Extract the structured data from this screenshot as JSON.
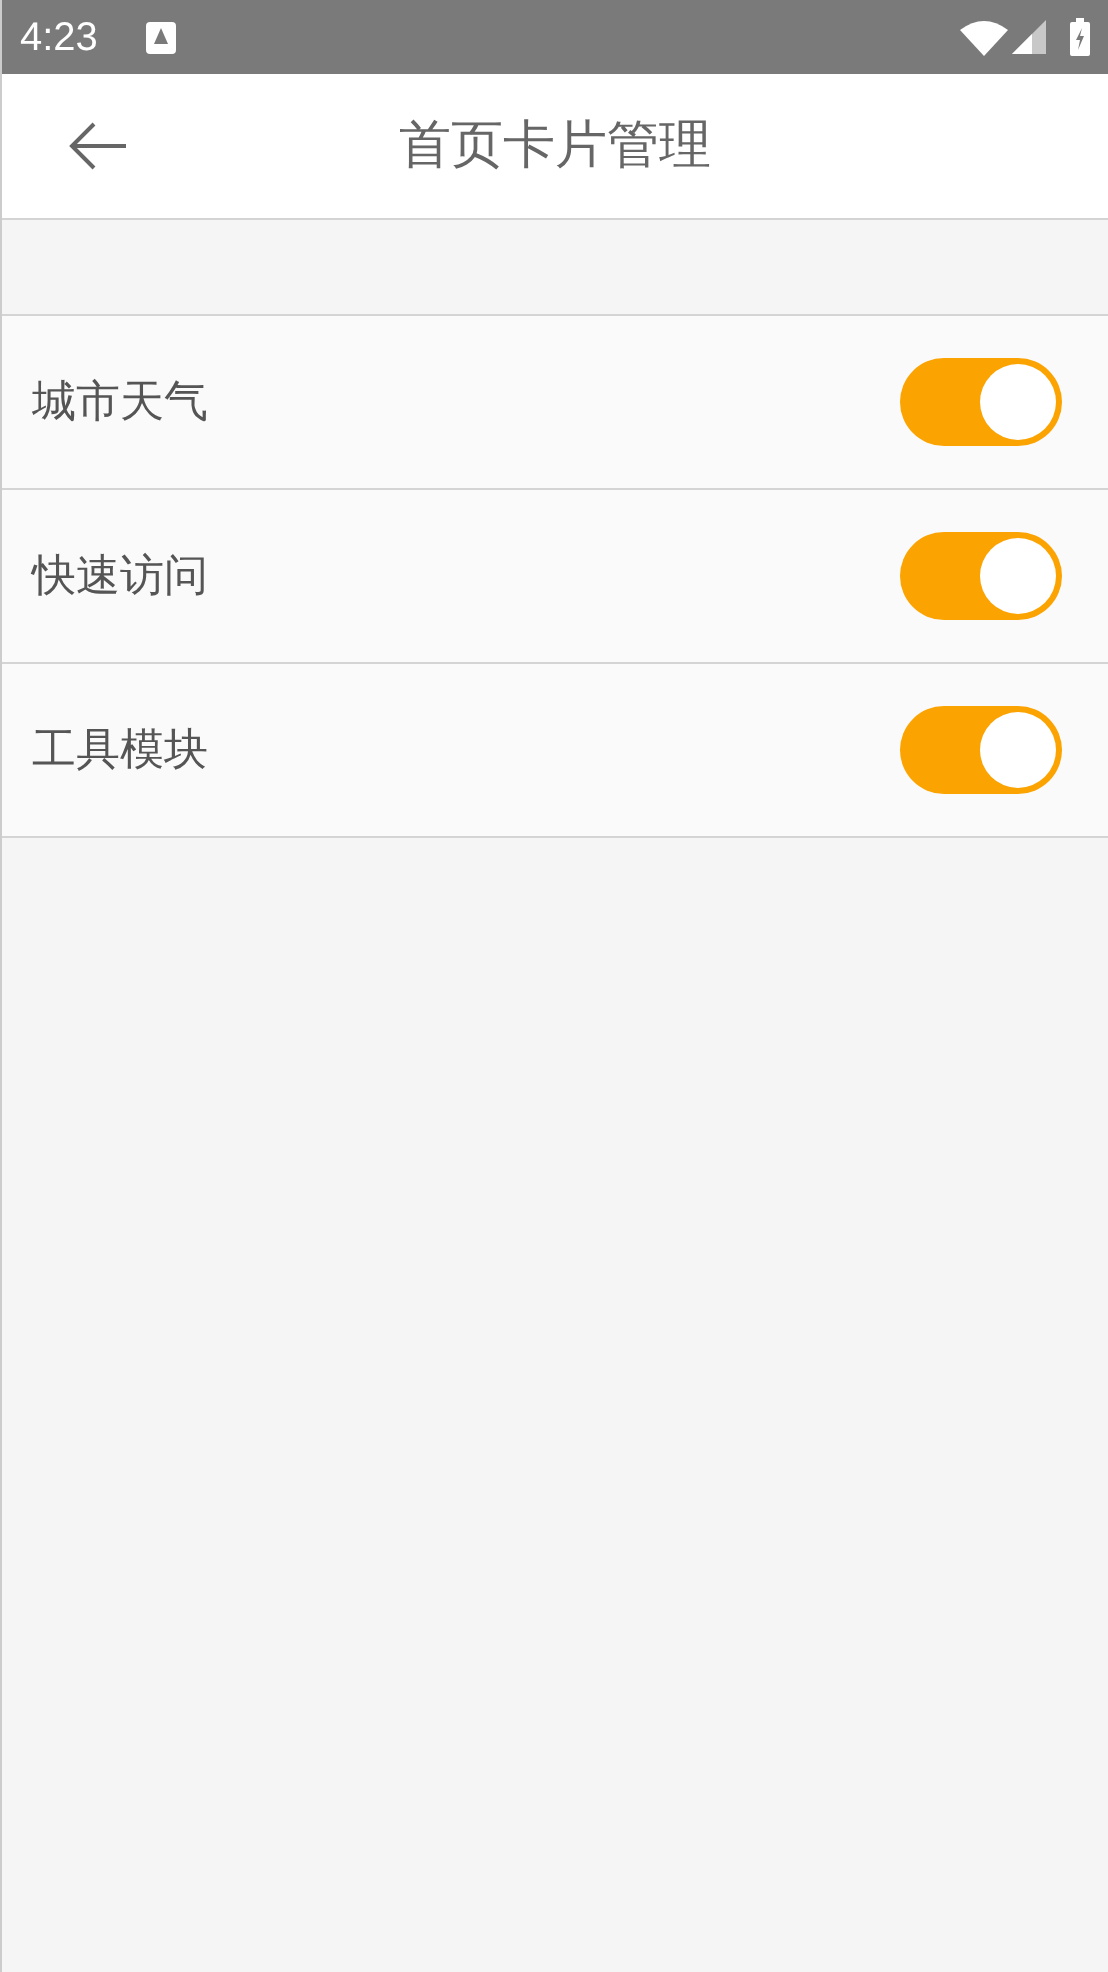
{
  "status_bar": {
    "time": "4:23"
  },
  "header": {
    "title": "首页卡片管理"
  },
  "settings": [
    {
      "label": "城市天气",
      "on": true
    },
    {
      "label": "快速访问",
      "on": true
    },
    {
      "label": "工具模块",
      "on": true
    }
  ]
}
